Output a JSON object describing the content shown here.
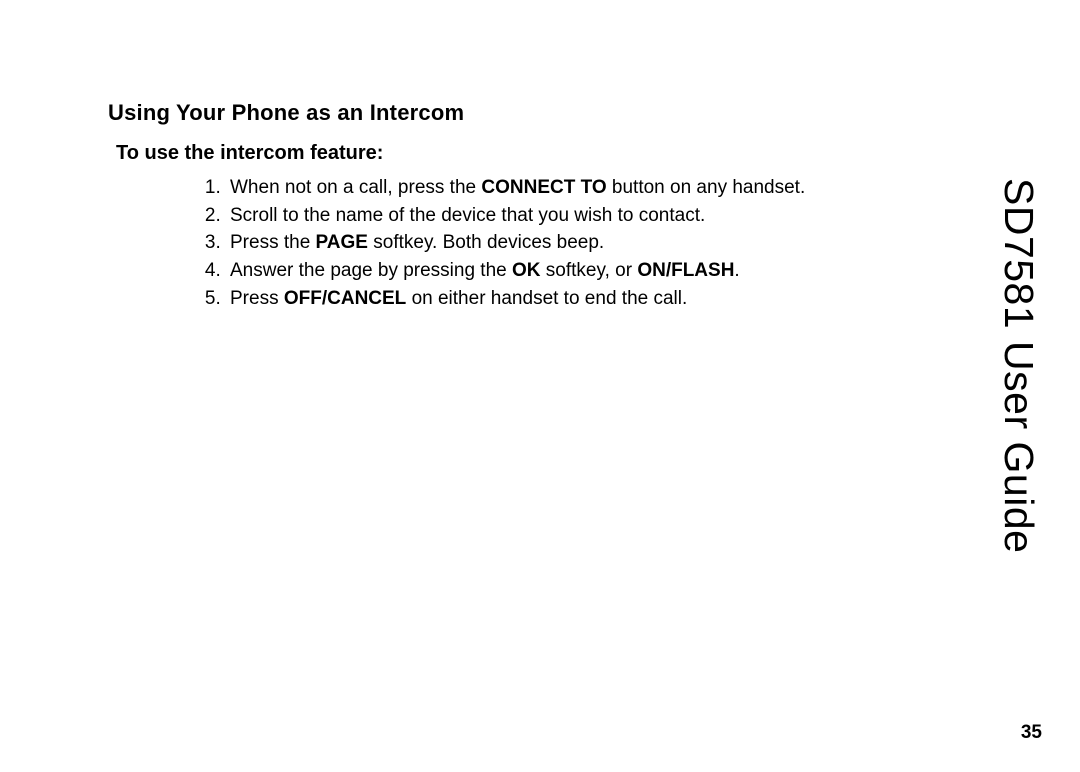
{
  "side_title": "SD7581 User Guide",
  "page_number": "35",
  "heading": "Using Your Phone as an Intercom",
  "subheading": "To use the intercom feature:",
  "steps": [
    {
      "pre": "When not on a call, press the ",
      "bold1": "CONNECT TO",
      "mid": " button on any handset.",
      "bold2": "",
      "post": ""
    },
    {
      "pre": "Scroll to the name of the device that you wish to contact.",
      "bold1": "",
      "mid": "",
      "bold2": "",
      "post": ""
    },
    {
      "pre": "Press the ",
      "bold1": "PAGE",
      "mid": " softkey. Both devices beep.",
      "bold2": "",
      "post": ""
    },
    {
      "pre": "Answer the page by pressing the ",
      "bold1": "OK",
      "mid": " softkey, or ",
      "bold2": "ON/FLASH",
      "post": "."
    },
    {
      "pre": "Press ",
      "bold1": "OFF/CANCEL",
      "mid": " on either handset to end the call.",
      "bold2": "",
      "post": ""
    }
  ]
}
